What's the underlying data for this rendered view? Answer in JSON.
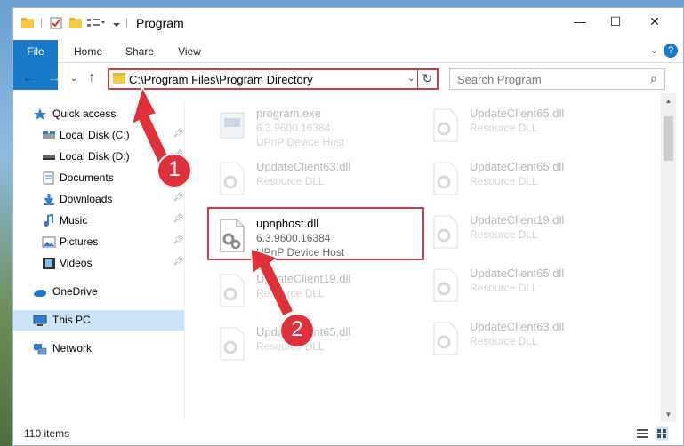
{
  "titlebar": {
    "title": "Program",
    "minimize": "—",
    "maximize": "☐",
    "close": "✕"
  },
  "ribbon": {
    "tabs": [
      "File",
      "Home",
      "Share",
      "View"
    ],
    "help": "?"
  },
  "address": {
    "path": "C:\\Program Files\\Program Directory",
    "refresh": "↻"
  },
  "search": {
    "placeholder": "Search Program"
  },
  "sidebar": {
    "items": [
      {
        "label": "Quick access",
        "icon": "star-icon"
      },
      {
        "label": "Local Disk (C:)",
        "icon": "disk-icon"
      },
      {
        "label": "Local Disk (D:)",
        "icon": "disk-icon"
      },
      {
        "label": "Documents",
        "icon": "documents-icon"
      },
      {
        "label": "Downloads",
        "icon": "download-icon"
      },
      {
        "label": "Music",
        "icon": "music-icon"
      },
      {
        "label": "Pictures",
        "icon": "pictures-icon"
      },
      {
        "label": "Videos",
        "icon": "videos-icon"
      },
      {
        "label": "OneDrive",
        "icon": "cloud-icon"
      },
      {
        "label": "This PC",
        "icon": "computer-icon"
      },
      {
        "label": "Network",
        "icon": "network-icon"
      }
    ]
  },
  "files": {
    "col1": [
      {
        "name": "program.exe",
        "version": "6.3.9600.16384",
        "desc": "UPnP Device Host"
      },
      {
        "name": "UpdateClient63.dll",
        "version": "",
        "desc": "Resource DLL"
      },
      {
        "name": "upnphost.dll",
        "version": "6.3.9600.16384",
        "desc": "UPnP Device Host"
      },
      {
        "name": "UpdateClient19.dll",
        "version": "",
        "desc": "Resource DLL"
      },
      {
        "name": "UpdateClient65.dll",
        "version": "",
        "desc": "Resource DLL"
      }
    ],
    "col2": [
      {
        "name": "UpdateClient65.dll",
        "version": "",
        "desc": "Resource DLL"
      },
      {
        "name": "UpdateClient65.dll",
        "version": "",
        "desc": "Resource DLL"
      },
      {
        "name": "UpdateClient19.dll",
        "version": "",
        "desc": "Resource DLL"
      },
      {
        "name": "UpdateClient65.dll",
        "version": "",
        "desc": "Resource DLL"
      },
      {
        "name": "UpdateClient63.dll",
        "version": "",
        "desc": "Resource DLL"
      }
    ]
  },
  "status": {
    "count": "110 items"
  },
  "annotations": {
    "step1": "1",
    "step2": "2"
  },
  "colors": {
    "accent": "#1979ca",
    "highlight": "#d9363e",
    "selected": "#cce4f7"
  }
}
